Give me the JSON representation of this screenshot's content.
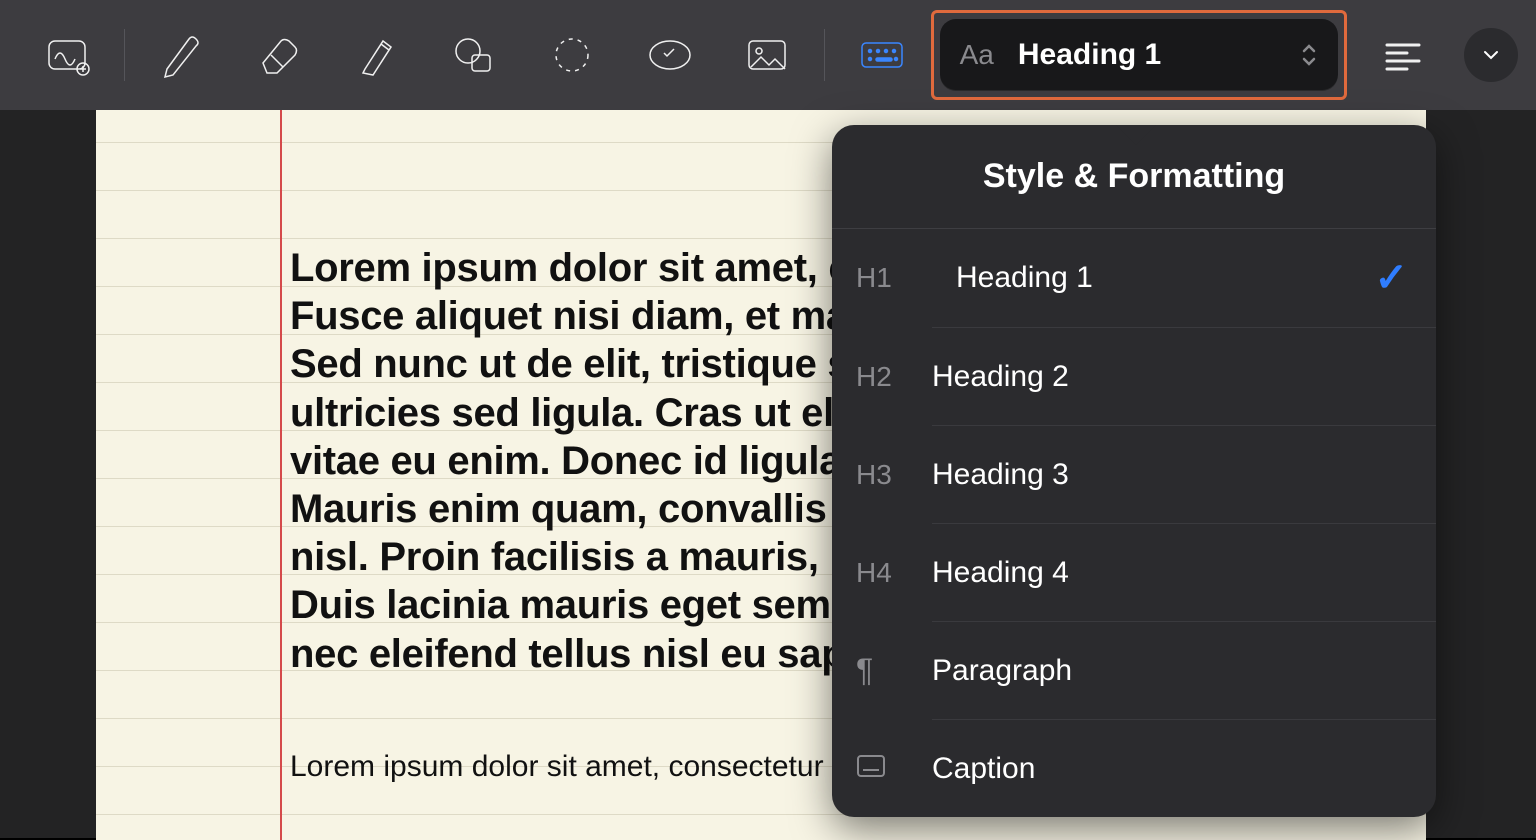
{
  "toolbar": {
    "style_label": "Heading 1",
    "style_prefix": "Aa"
  },
  "popover": {
    "title": "Style & Formatting",
    "items": [
      {
        "prefix": "H1",
        "label": "Heading 1",
        "selected": true
      },
      {
        "prefix": "H2",
        "label": "Heading 2",
        "selected": false
      },
      {
        "prefix": "H3",
        "label": "Heading 3",
        "selected": false
      },
      {
        "prefix": "H4",
        "label": "Heading 4",
        "selected": false
      },
      {
        "prefix": "¶",
        "label": "Paragraph",
        "selected": false,
        "icon": "pilcrow"
      },
      {
        "prefix": "",
        "label": "Caption",
        "selected": false,
        "icon": "caption"
      }
    ]
  },
  "document": {
    "heading_text": "Lorem ipsum dolor sit amet, consectetur adipiscing elit. Fusce aliquet nisi diam, et maximus quam sodales sed. Sed nunc ut de elit, tristique sed tincidunt ultricies, ultricies sed ligula. Cras ut elit tempor, nec consectetur vitae eu enim. Donec id ligula porttitor efficitur aliquam. Mauris enim quam, convallis eu tincidunt et, dictum quis nisl. Proin facilisis a mauris, nec cursus magna tristique. Duis lacinia mauris eget semper ultricies, nibh lacus quis, nec eleifend tellus nisl eu sapien.",
    "paragraph_text": "Lorem ipsum dolor sit amet, consectetur adipiscing elit."
  }
}
